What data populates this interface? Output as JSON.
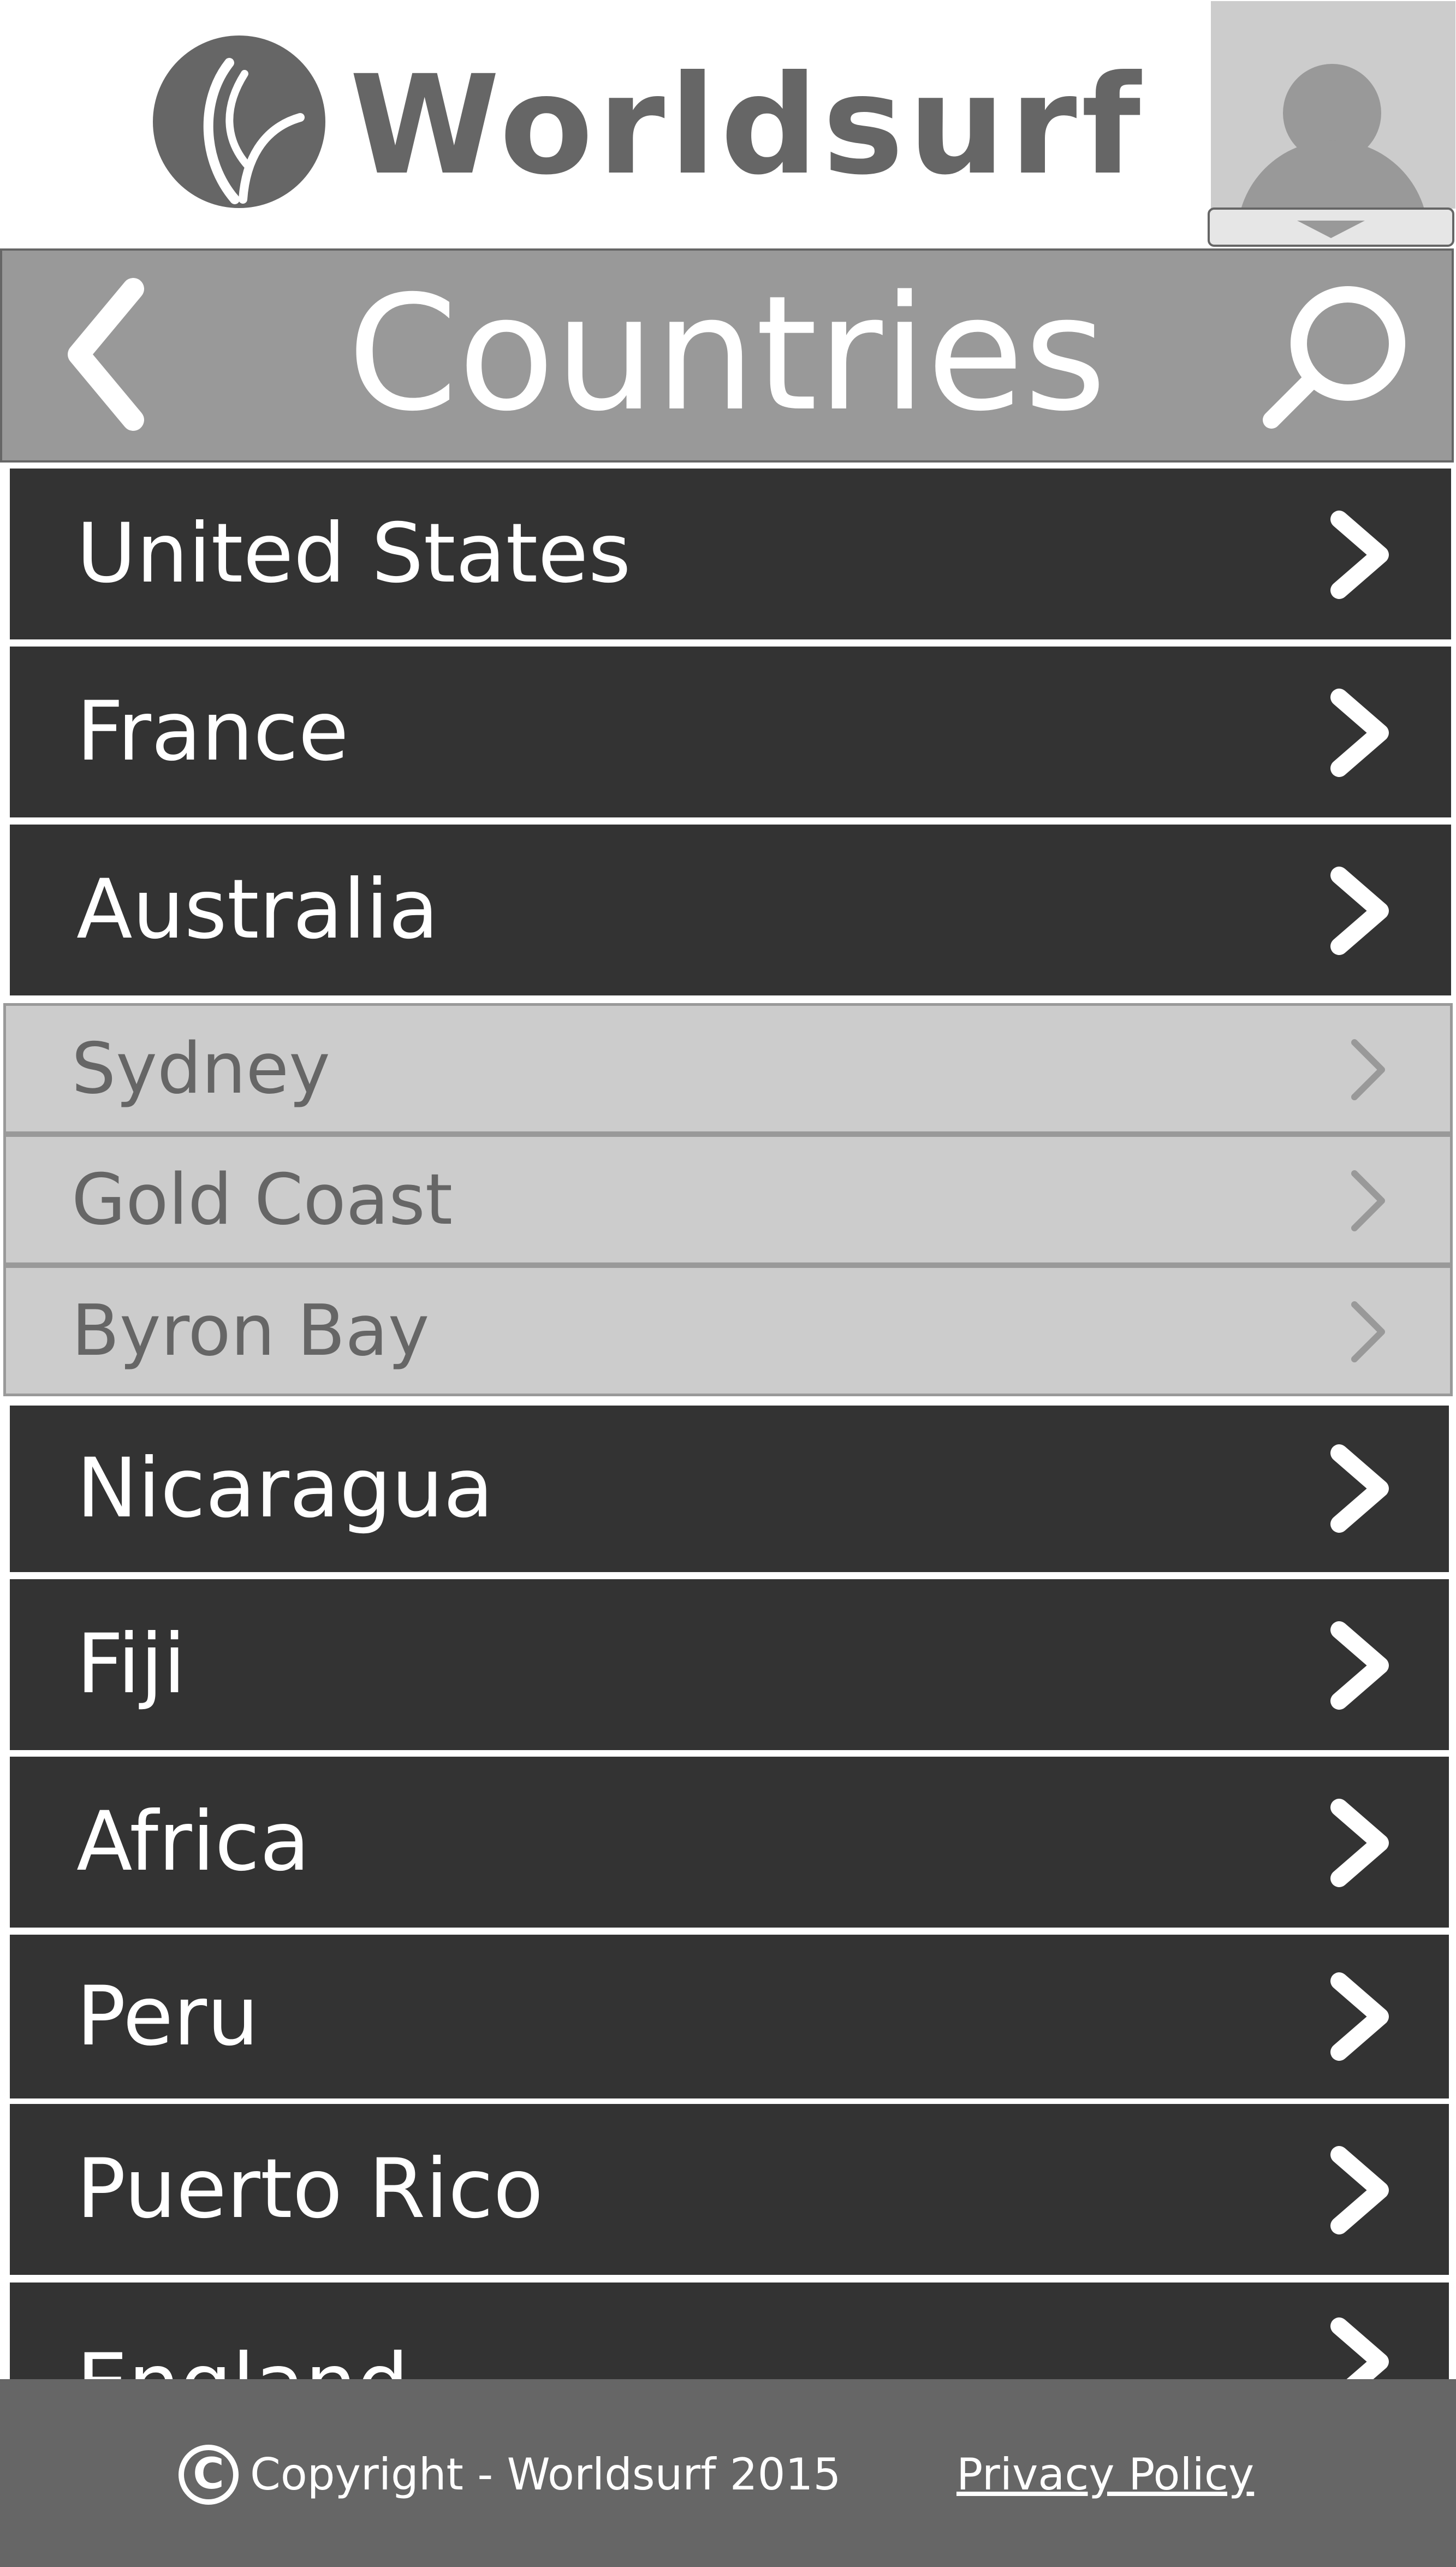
{
  "header": {
    "app_name": "Worldsurf",
    "logo_icon": "wave-logo-icon",
    "avatar_icon": "user-avatar-icon",
    "avatar_dropdown_icon": "caret-down-icon"
  },
  "titlebar": {
    "title": "Countries",
    "back_icon": "chevron-left-icon",
    "search_icon": "search-icon"
  },
  "countries": {
    "top": [
      "United States",
      "France",
      "Australia"
    ],
    "australia_sub": [
      "Sydney",
      "Gold Coast",
      "Byron Bay"
    ],
    "bottom": [
      "Nicaragua",
      "Fiji",
      "Africa",
      "Peru",
      "Puerto Rico",
      "England"
    ]
  },
  "footer": {
    "copyright_symbol": "C",
    "copyright": "Copyright - Worldsurf 2015",
    "privacy": "Privacy Policy"
  },
  "colors": {
    "row_dark": "#333333",
    "row_light": "#cccccc",
    "titlebar": "#999999",
    "footer": "#666666",
    "logo": "#666666"
  }
}
